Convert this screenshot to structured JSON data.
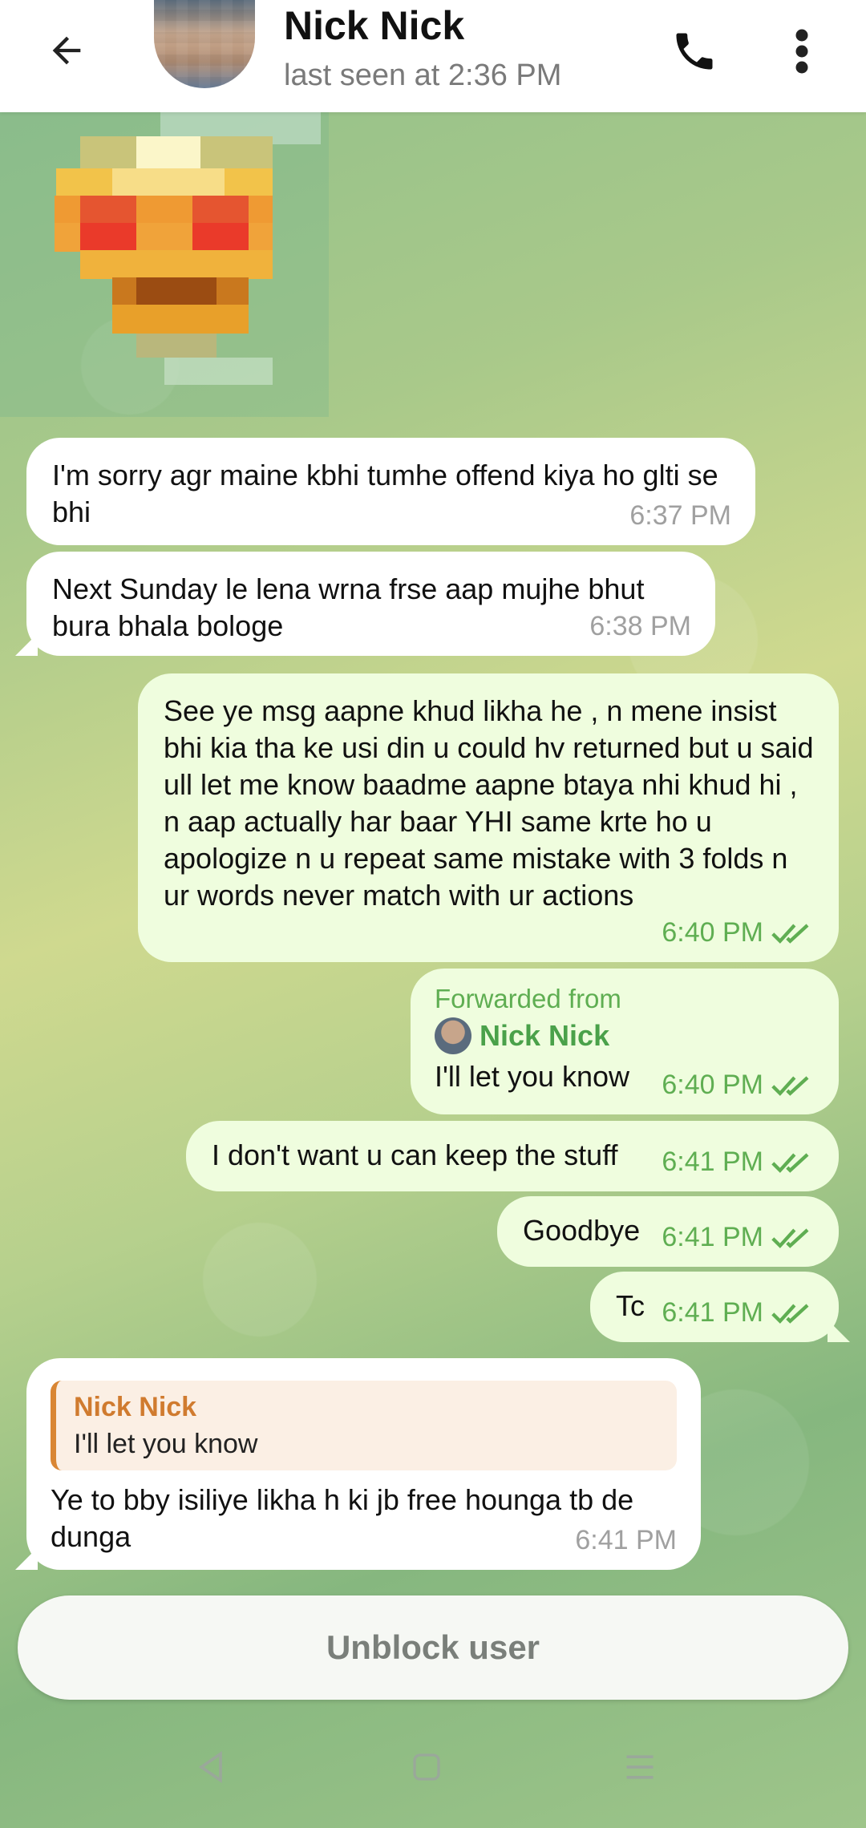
{
  "header": {
    "contact_name": "Nick Nick",
    "status": "last seen at 2:36 PM",
    "icons": [
      "back-arrow-icon",
      "phone-icon",
      "more-vert-icon"
    ]
  },
  "messages": [
    {
      "direction": "in",
      "text": "I'm sorry agr maine kbhi tumhe offend kiya ho glti se bhi",
      "time": "6:37 PM"
    },
    {
      "direction": "in",
      "text": "Next Sunday le lena wrna frse aap mujhe bhut bura bhala bologe",
      "time": "6:38 PM"
    },
    {
      "direction": "out",
      "text": "See ye msg aapne khud likha he , n mene insist bhi kia tha ke usi din u could hv returned but u said ull let me know baadme aapne btaya nhi khud hi , n aap actually har baar YHI same krte ho u apologize n u repeat same mistake with 3 folds n ur words never match with ur actions",
      "time": "6:40 PM"
    },
    {
      "direction": "out",
      "forwarded_label": "Forwarded from",
      "forwarded_from": "Nick Nick",
      "text": "I'll let you know",
      "time": "6:40 PM"
    },
    {
      "direction": "out",
      "text": "I don't want u can keep the stuff",
      "time": "6:41 PM"
    },
    {
      "direction": "out",
      "text": "Goodbye",
      "time": "6:41 PM"
    },
    {
      "direction": "out",
      "text": "Tc",
      "time": "6:41 PM"
    },
    {
      "direction": "in",
      "reply_name": "Nick Nick",
      "reply_text": "I'll let you know",
      "text": "Ye to bby isiliye likha h ki jb free hounga tb de dunga",
      "time": "6:41 PM"
    }
  ],
  "unblock_label": "Unblock user",
  "colors": {
    "outgoing_bubble": "#effdde",
    "incoming_bubble": "#ffffff",
    "check_green": "#5fae52",
    "reply_accent": "#d07b2f"
  }
}
